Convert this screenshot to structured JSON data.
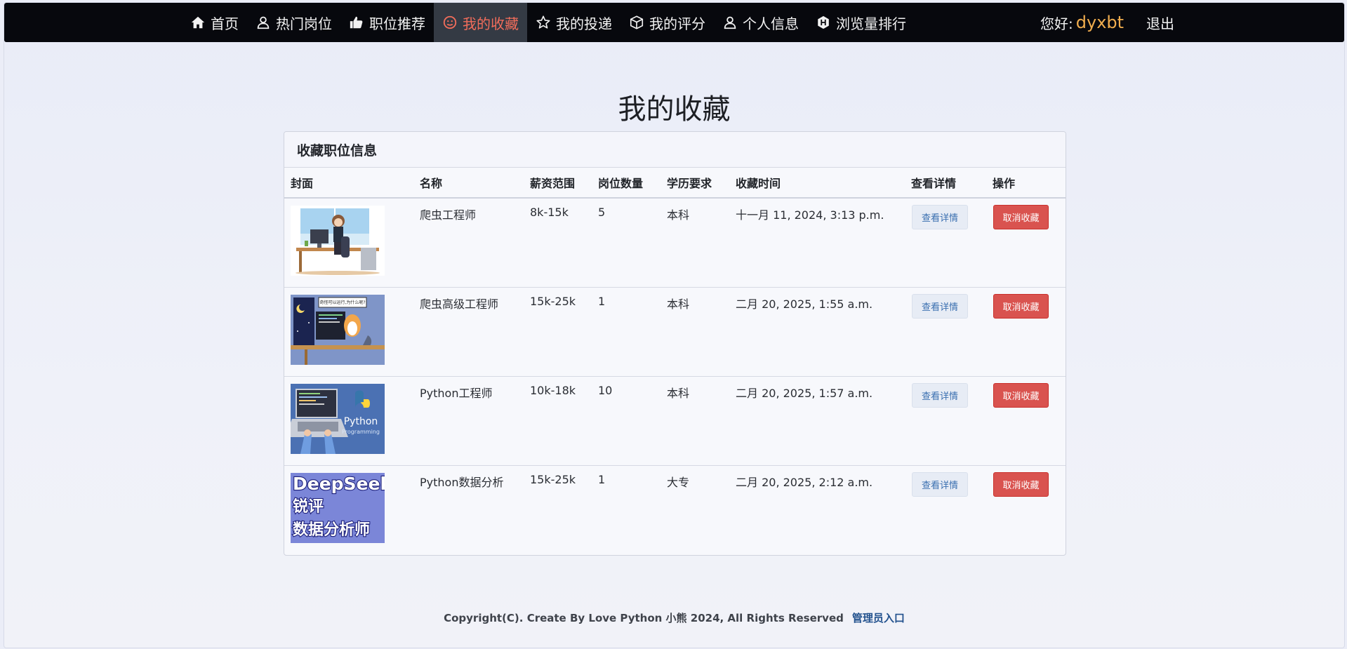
{
  "nav": {
    "items": [
      {
        "label": "首页",
        "icon": "home-icon",
        "active": false
      },
      {
        "label": "热门岗位",
        "icon": "person-icon",
        "active": false
      },
      {
        "label": "职位推荐",
        "icon": "thumbs-up-icon",
        "active": false
      },
      {
        "label": "我的收藏",
        "icon": "smiley-icon",
        "active": true
      },
      {
        "label": "我的投递",
        "icon": "star-icon",
        "active": false
      },
      {
        "label": "我的评分",
        "icon": "cube-icon",
        "active": false
      },
      {
        "label": "个人信息",
        "icon": "person-icon",
        "active": false
      },
      {
        "label": "浏览量排行",
        "icon": "hexagon-h-icon",
        "active": false
      }
    ],
    "greeting": "您好:",
    "username": "dyxbt",
    "logout": "退出"
  },
  "page": {
    "title": "我的收藏"
  },
  "card": {
    "header": "收藏职位信息",
    "columns": [
      "封面",
      "名称",
      "薪资范围",
      "岗位数量",
      "学历要求",
      "收藏时间",
      "查看详情",
      "操作"
    ],
    "rows": [
      {
        "cover": "cover-illustration-office-girl",
        "name": "爬虫工程师",
        "salary": "8k-15k",
        "count": "5",
        "education": "本科",
        "time": "十一月 11, 2024, 3:13 p.m.",
        "detail": "查看详情",
        "action": "取消收藏"
      },
      {
        "cover": "cover-illustration-cat-coder",
        "name": "爬虫高级工程师",
        "salary": "15k-25k",
        "count": "1",
        "education": "本科",
        "time": "二月 20, 2025, 1:55 a.m.",
        "detail": "查看详情",
        "action": "取消收藏"
      },
      {
        "cover": "cover-python-programming",
        "name": "Python工程师",
        "salary": "10k-18k",
        "count": "10",
        "education": "本科",
        "time": "二月 20, 2025, 1:57 a.m.",
        "detail": "查看详情",
        "action": "取消收藏"
      },
      {
        "cover": "cover-deepseek",
        "name": "Python数据分析",
        "salary": "15k-25k",
        "count": "1",
        "education": "大专",
        "time": "二月 20, 2025, 2:12 a.m.",
        "detail": "查看详情",
        "action": "取消收藏"
      }
    ],
    "cover_text": {
      "python_title": "Python",
      "python_sub": "Programming",
      "deepseek_1": "DeepSeek",
      "deepseek_2": "锐评",
      "deepseek_3": "数据分析师",
      "cat_bubble": "奇怪可以运行,为什么呢?"
    }
  },
  "footer": {
    "copyright": "Copyright(C). Create By Love Python 小熊 2024, All Rights Reserved",
    "admin": "管理员入口"
  },
  "colors": {
    "navbar_bg": "#07080d",
    "active_text": "#f26d5b",
    "username": "#f0ad4e",
    "danger": "#d9534f",
    "link": "#23528e"
  }
}
